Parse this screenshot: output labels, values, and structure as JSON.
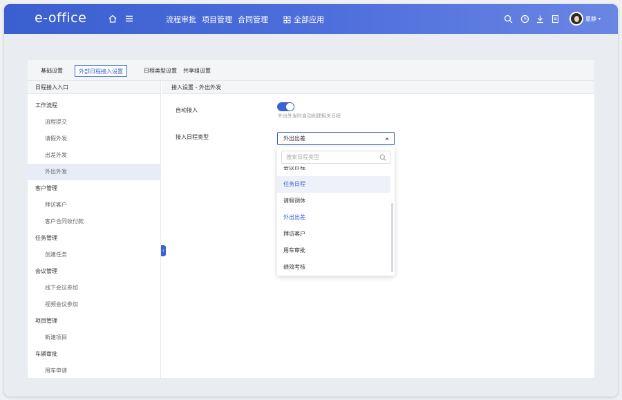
{
  "header": {
    "logo": "e-office",
    "nav": [
      "流程审批",
      "项目管理",
      "合同管理"
    ],
    "all_apps": "全部应用",
    "user_name": "夏静"
  },
  "tabs": [
    {
      "label": "基础设置",
      "active": false
    },
    {
      "label": "外部日程接入设置",
      "active": true
    },
    {
      "label": "日程类型设置",
      "active": false
    },
    {
      "label": "共享组设置",
      "active": false
    }
  ],
  "left": {
    "header": "日程接入入口",
    "tree": [
      {
        "label": "工作流程",
        "type": "group"
      },
      {
        "label": "流程提交",
        "type": "child"
      },
      {
        "label": "请假外发",
        "type": "child"
      },
      {
        "label": "出差外发",
        "type": "child"
      },
      {
        "label": "外出外发",
        "type": "child",
        "selected": true
      },
      {
        "label": "客户管理",
        "type": "group"
      },
      {
        "label": "拜访客户",
        "type": "child"
      },
      {
        "label": "客户合同收付款",
        "type": "child"
      },
      {
        "label": "任务管理",
        "type": "group"
      },
      {
        "label": "创建任务",
        "type": "child"
      },
      {
        "label": "会议管理",
        "type": "group"
      },
      {
        "label": "线下会议参加",
        "type": "child"
      },
      {
        "label": "视频会议参加",
        "type": "child"
      },
      {
        "label": "项目管理",
        "type": "group"
      },
      {
        "label": "新建项目",
        "type": "child"
      },
      {
        "label": "车辆审批",
        "type": "group"
      },
      {
        "label": "用车申请",
        "type": "child"
      }
    ]
  },
  "right": {
    "header": "接入设置 - 外出外发",
    "auto_label": "自动接入",
    "auto_enabled": true,
    "auto_hint": "外出外发时自动创建相关日程",
    "type_label": "接入日程类型",
    "type_value": "外出出差",
    "search_placeholder": "搜索日程类型",
    "options": [
      {
        "label": "会议日程",
        "state": "cut"
      },
      {
        "label": "任务日程",
        "state": "hover"
      },
      {
        "label": "请假调休",
        "state": ""
      },
      {
        "label": "外出出差",
        "state": "selected"
      },
      {
        "label": "拜访客户",
        "state": ""
      },
      {
        "label": "用车审批",
        "state": ""
      },
      {
        "label": "绩效考核",
        "state": ""
      }
    ]
  }
}
